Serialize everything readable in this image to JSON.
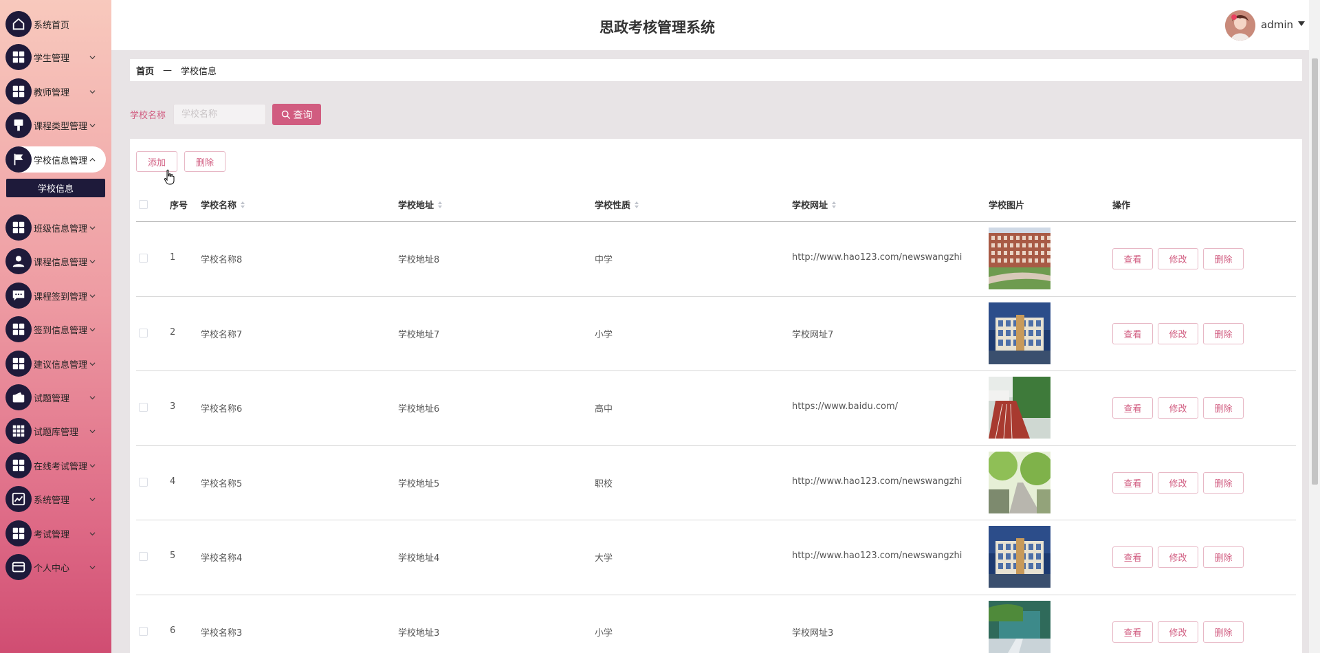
{
  "app": {
    "title": "思政考核管理系统",
    "user": "admin"
  },
  "sidebar": {
    "items": [
      {
        "label": "系统首页",
        "icon": "home-icon",
        "chevron": false
      },
      {
        "label": "学生管理",
        "icon": "grid-icon",
        "chevron": true
      },
      {
        "label": "教师管理",
        "icon": "grid-icon",
        "chevron": true
      },
      {
        "label": "课程类型管理",
        "icon": "brush-icon",
        "chevron": true
      },
      {
        "label": "学校信息管理",
        "icon": "flag-icon",
        "chevron": true,
        "expanded": true
      },
      {
        "label": "班级信息管理",
        "icon": "grid-icon",
        "chevron": true
      },
      {
        "label": "课程信息管理",
        "icon": "user-icon",
        "chevron": true
      },
      {
        "label": "课程签到管理",
        "icon": "chat-icon",
        "chevron": true
      },
      {
        "label": "签到信息管理",
        "icon": "grid-icon",
        "chevron": true
      },
      {
        "label": "建议信息管理",
        "icon": "grid-icon",
        "chevron": true
      },
      {
        "label": "试题管理",
        "icon": "wallet-icon",
        "chevron": true
      },
      {
        "label": "试题库管理",
        "icon": "table-icon",
        "chevron": true
      },
      {
        "label": "在线考试管理",
        "icon": "grid-icon",
        "chevron": true
      },
      {
        "label": "系统管理",
        "icon": "chart-icon",
        "chevron": true
      },
      {
        "label": "考试管理",
        "icon": "grid-icon",
        "chevron": true
      },
      {
        "label": "个人中心",
        "icon": "card-icon",
        "chevron": true
      }
    ],
    "submenu": {
      "label": "学校信息"
    }
  },
  "breadcrumb": {
    "home": "首页",
    "separator": "—",
    "current": "学校信息"
  },
  "search": {
    "label": "学校名称",
    "placeholder": "学校名称",
    "button": "查询"
  },
  "toolbar": {
    "add": "添加",
    "delete": "删除"
  },
  "table": {
    "columns": [
      "序号",
      "学校名称",
      "学校地址",
      "学校性质",
      "学校网址",
      "学校图片",
      "操作"
    ],
    "rows": [
      {
        "index": "1",
        "name": "学校名称8",
        "address": "学校地址8",
        "type": "中学",
        "url": "http://www.hao123.com/newswangzhi",
        "image": "brick-building"
      },
      {
        "index": "2",
        "name": "学校名称7",
        "address": "学校地址7",
        "type": "小学",
        "url": "学校网址7",
        "image": "modern-building"
      },
      {
        "index": "3",
        "name": "学校名称6",
        "address": "学校地址6",
        "type": "高中",
        "url": "https://www.baidu.com/",
        "image": "running-track"
      },
      {
        "index": "4",
        "name": "学校名称5",
        "address": "学校地址5",
        "type": "职校",
        "url": "http://www.hao123.com/newswangzhi",
        "image": "tree-road"
      },
      {
        "index": "5",
        "name": "学校名称4",
        "address": "学校地址4",
        "type": "大学",
        "url": "http://www.hao123.com/newswangzhi",
        "image": "modern-building"
      },
      {
        "index": "6",
        "name": "学校名称3",
        "address": "学校地址3",
        "type": "小学",
        "url": "学校网址3",
        "image": "courtyard"
      }
    ],
    "actions": {
      "view": "查看",
      "edit": "修改",
      "delete": "删除"
    }
  },
  "colors": {
    "accent": "#d15c80",
    "sidebar_icon_bg": "#1e1a3a"
  }
}
